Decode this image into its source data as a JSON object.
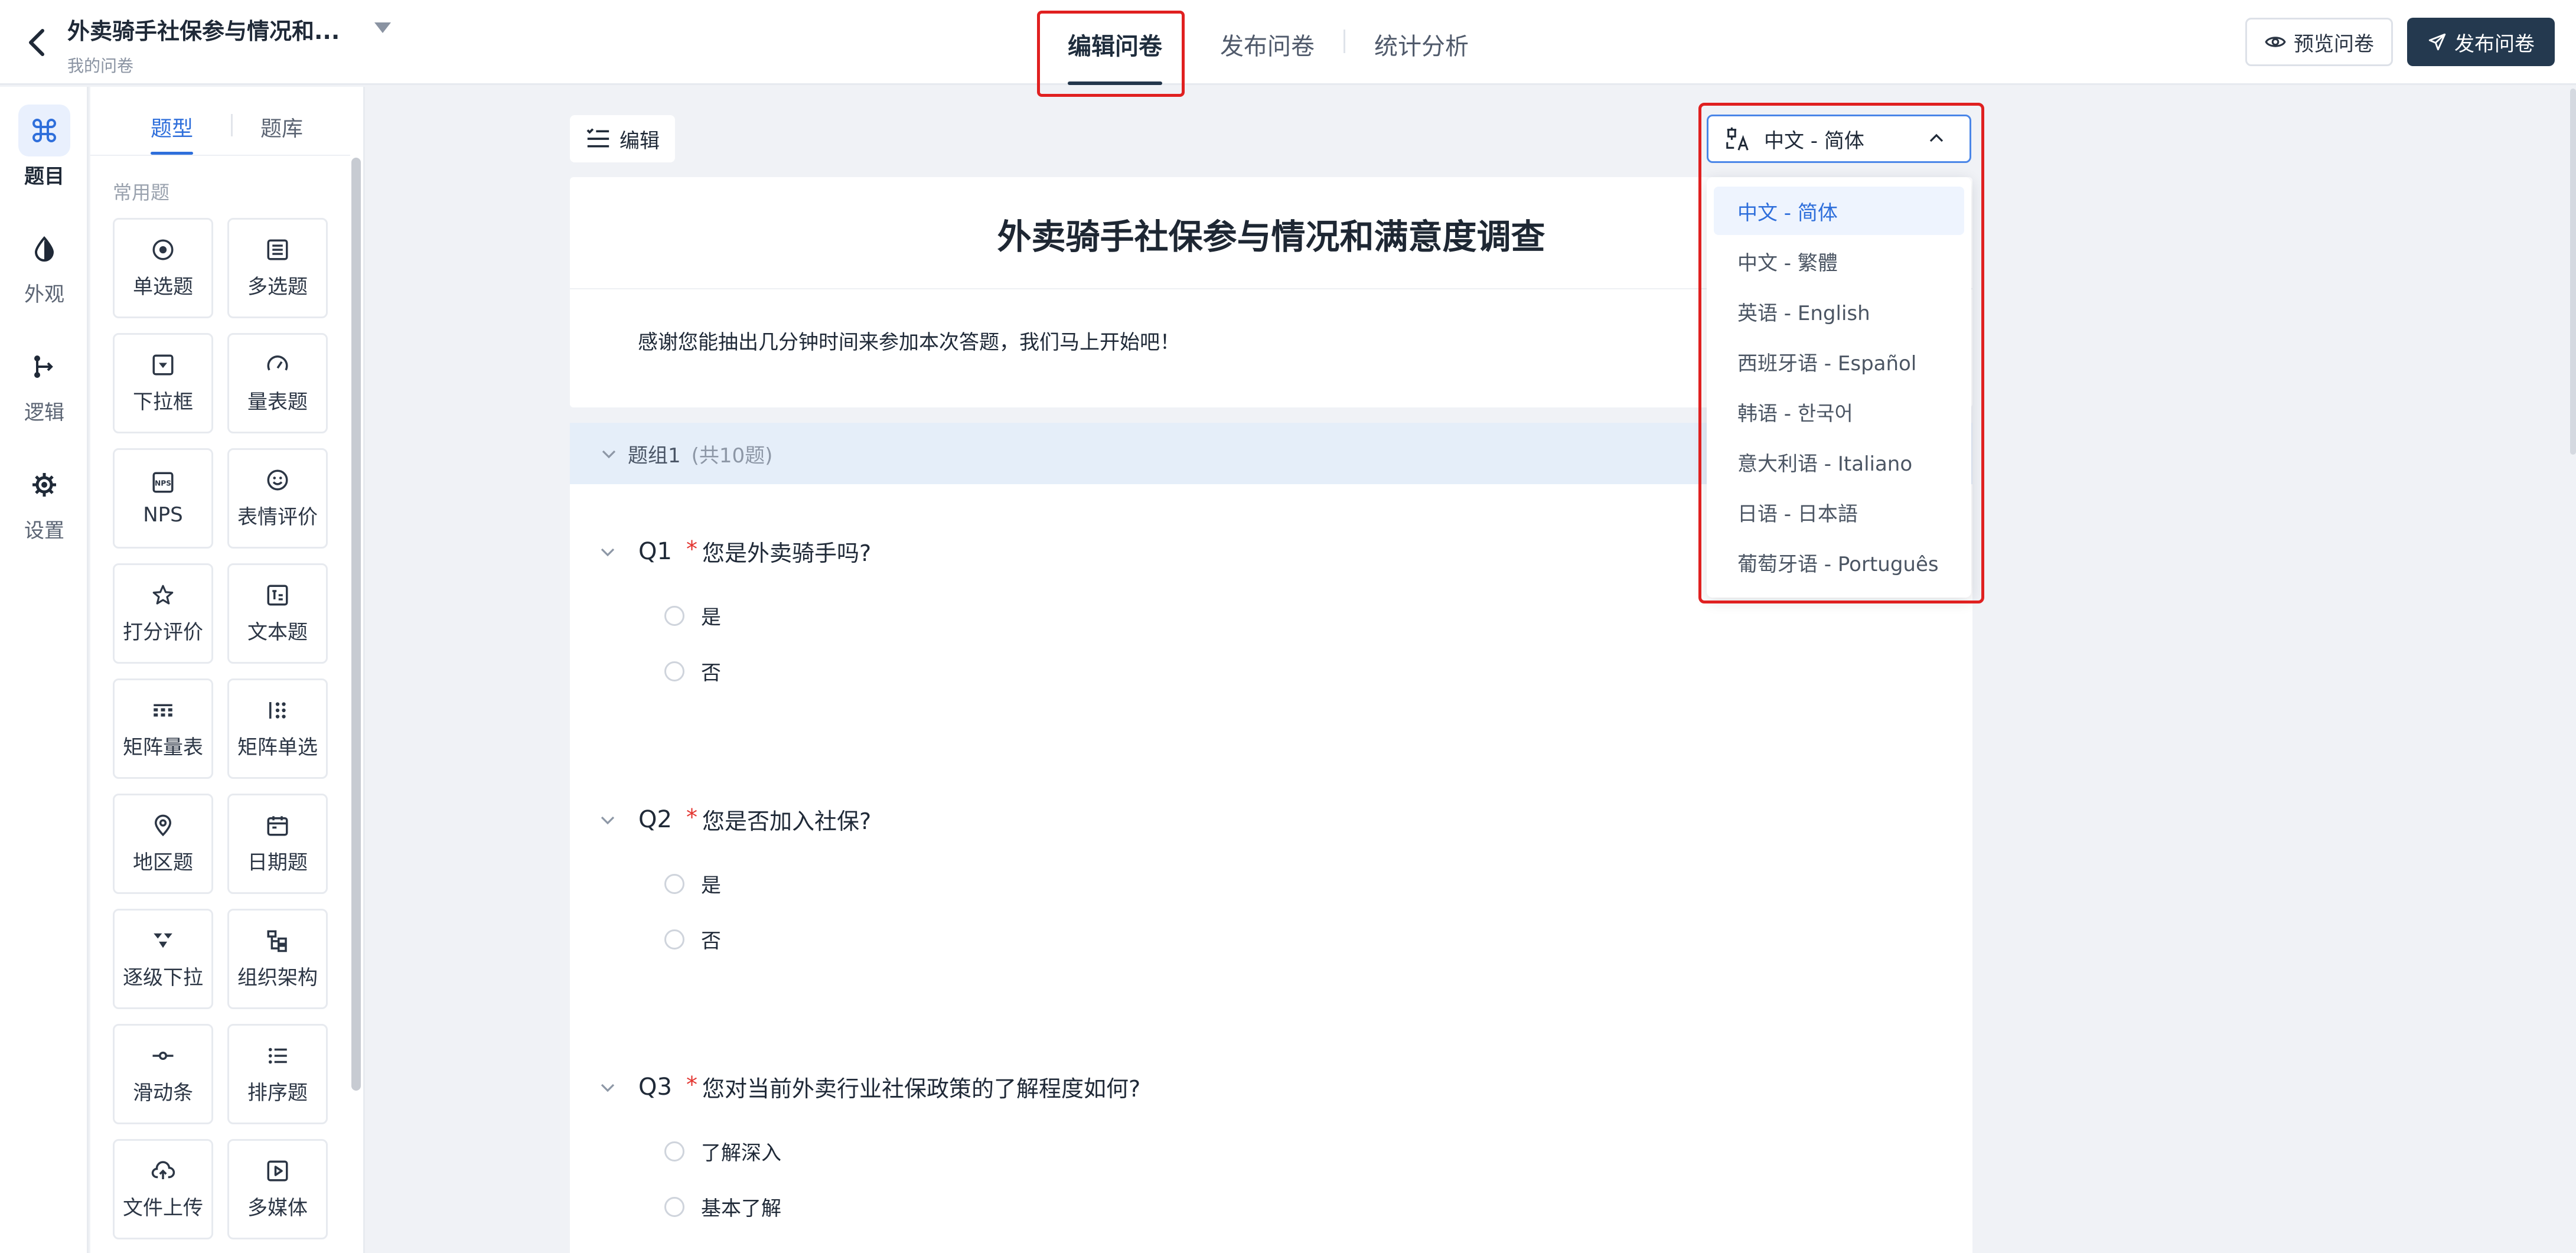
{
  "header": {
    "survey_title": "外卖骑手社保参与情况和...",
    "breadcrumb": "我的问卷",
    "tabs": [
      {
        "label": "编辑问卷",
        "active": true
      },
      {
        "label": "发布问卷",
        "active": false
      },
      {
        "label": "统计分析",
        "active": false
      }
    ],
    "preview_label": "预览问卷",
    "publish_label": "发布问卷",
    "accent_color": "#24394f",
    "highlight_color": "#e02020"
  },
  "rail": {
    "items": [
      {
        "label": "题目",
        "icon": "grid-command-icon",
        "active": true
      },
      {
        "label": "外观",
        "icon": "drop-icon",
        "active": false
      },
      {
        "label": "逻辑",
        "icon": "branch-icon",
        "active": false
      },
      {
        "label": "设置",
        "icon": "gear-icon",
        "active": false
      }
    ]
  },
  "palette": {
    "tab_type": "题型",
    "tab_bank": "题库",
    "section_label": "常用题",
    "items": [
      {
        "label": "单选题",
        "icon": "radio-icon"
      },
      {
        "label": "多选题",
        "icon": "checklist-icon"
      },
      {
        "label": "下拉框",
        "icon": "dropdown-icon"
      },
      {
        "label": "量表题",
        "icon": "gauge-icon"
      },
      {
        "label": "NPS",
        "icon": "nps-icon"
      },
      {
        "label": "表情评价",
        "icon": "smiley-icon"
      },
      {
        "label": "打分评价",
        "icon": "star-icon"
      },
      {
        "label": "文本题",
        "icon": "text-icon"
      },
      {
        "label": "矩阵量表",
        "icon": "matrix-scale-icon"
      },
      {
        "label": "矩阵单选",
        "icon": "matrix-radio-icon"
      },
      {
        "label": "地区题",
        "icon": "location-icon"
      },
      {
        "label": "日期题",
        "icon": "calendar-icon"
      },
      {
        "label": "逐级下拉",
        "icon": "cascade-icon"
      },
      {
        "label": "组织架构",
        "icon": "org-chart-icon"
      },
      {
        "label": "滑动条",
        "icon": "slider-icon"
      },
      {
        "label": "排序题",
        "icon": "sort-list-icon"
      },
      {
        "label": "文件上传",
        "icon": "upload-icon"
      },
      {
        "label": "多媒体",
        "icon": "media-icon"
      }
    ]
  },
  "editor": {
    "edit_label": "编辑",
    "survey_title": "外卖骑手社保参与情况和满意度调查",
    "welcome": "感谢您能抽出几分钟时间来参加本次答题，我们马上开始吧！",
    "group_name": "题组1",
    "group_count": "(共10题)",
    "questions": [
      {
        "num": "Q1",
        "required": "*",
        "text": "您是外卖骑手吗?",
        "options": [
          "是",
          "否"
        ]
      },
      {
        "num": "Q2",
        "required": "*",
        "text": "您是否加入社保?",
        "options": [
          "是",
          "否"
        ]
      },
      {
        "num": "Q3",
        "required": "*",
        "text": "您对当前外卖行业社保政策的了解程度如何?",
        "options": [
          "了解深入",
          "基本了解"
        ]
      }
    ]
  },
  "language": {
    "selected": "中文 - 简体",
    "options": [
      "中文 - 简体",
      "中文 - 繁體",
      "英语 - English",
      "西班牙语 - Español",
      "韩语 - 한국어",
      "意大利语 - Italiano",
      "日语 - 日本語",
      "葡萄牙语 - Português"
    ]
  }
}
